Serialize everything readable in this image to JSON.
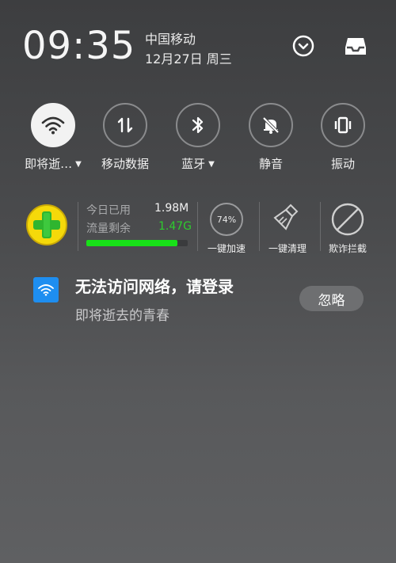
{
  "status": {
    "time": "09:35",
    "carrier": "中国移动",
    "date": "12月27日 周三"
  },
  "header_icons": {
    "expand": "chevron-down-circle-icon",
    "inbox": "inbox-tray-icon"
  },
  "toggles": [
    {
      "label": "即将逝…",
      "icon": "wifi-icon",
      "active": true,
      "has_caret": true
    },
    {
      "label": "移动数据",
      "icon": "mobile-data-icon",
      "active": false,
      "has_caret": false
    },
    {
      "label": "蓝牙",
      "icon": "bluetooth-icon",
      "active": false,
      "has_caret": true
    },
    {
      "label": "静音",
      "icon": "silent-bell-icon",
      "active": false,
      "has_caret": false
    },
    {
      "label": "振动",
      "icon": "vibrate-icon",
      "active": false,
      "has_caret": false
    }
  ],
  "cleaner": {
    "logo": "360-security-logo",
    "used_label": "今日已用",
    "used_value": "1.98M",
    "remaining_label": "流量剩余",
    "remaining_value": "1.47G",
    "remaining_color": "#2ecc2e",
    "usage_bar_fraction": 0.9,
    "tools": [
      {
        "label": "一键加速",
        "icon": "speedup-ring-icon",
        "percent": "74%"
      },
      {
        "label": "一键清理",
        "icon": "broom-icon"
      },
      {
        "label": "欺诈拦截",
        "icon": "block-icon"
      }
    ]
  },
  "notification": {
    "icon": "wifi-login-icon",
    "title": "无法访问网络，请登录",
    "subtitle": "即将逝去的青春",
    "button": "忽略"
  },
  "colors": {
    "wifi_notif_blue": "#1e8ef0",
    "bar_green": "#18e018"
  }
}
